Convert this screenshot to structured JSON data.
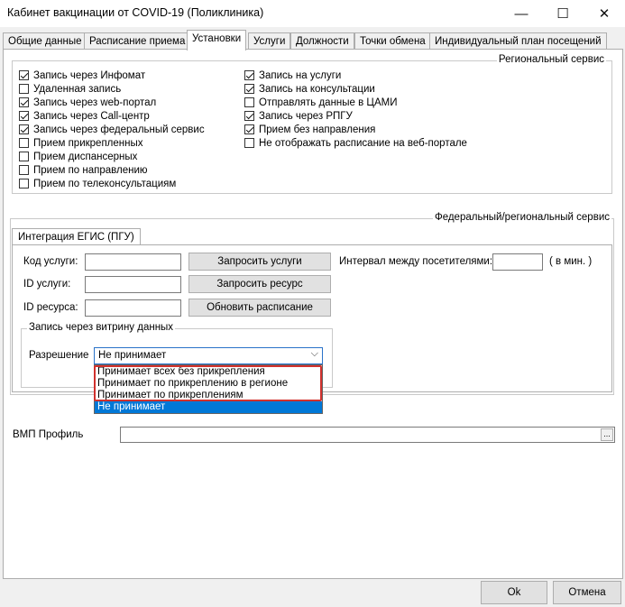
{
  "window": {
    "title": "Кабинет вакцинации от COVID-19 (Поликлиника)",
    "minimize_icon": "—",
    "maximize_icon": "☐",
    "close_icon": "✕"
  },
  "tabs": [
    {
      "label": "Общие данные"
    },
    {
      "label": "Расписание приема"
    },
    {
      "label": "Установки"
    },
    {
      "label": "Услуги"
    },
    {
      "label": "Должности"
    },
    {
      "label": "Точки обмена"
    },
    {
      "label": "Индивидуальный план посещений"
    }
  ],
  "regional": {
    "title": "Региональный сервис",
    "left": [
      {
        "label": "Запись через Инфомат",
        "checked": true
      },
      {
        "label": "Удаленная запись",
        "checked": false
      },
      {
        "label": "Запись через web-портал",
        "checked": true
      },
      {
        "label": "Запись через Call-центр",
        "checked": true
      },
      {
        "label": "Запись через федеральный сервис",
        "checked": true
      },
      {
        "label": "Прием прикрепленных",
        "checked": false
      },
      {
        "label": "Прием диспансерных",
        "checked": false
      },
      {
        "label": "Прием по направлению",
        "checked": false
      },
      {
        "label": "Прием по телеконсультациям",
        "checked": false
      }
    ],
    "right": [
      {
        "label": "Запись на услуги",
        "checked": true
      },
      {
        "label": "Запись на консультации",
        "checked": true
      },
      {
        "label": "Отправлять данные в ЦАМИ",
        "checked": false
      },
      {
        "label": "Запись через РПГУ",
        "checked": true
      },
      {
        "label": "Прием без направления",
        "checked": true
      },
      {
        "label": "Не отображать расписание на веб-портале",
        "checked": false
      }
    ]
  },
  "federal": {
    "title": "Федеральный/региональный сервис",
    "inner_tab": "Интеграция ЕГИС (ПГУ)",
    "service_code_label": "Код услуги:",
    "service_id_label": "ID услуги:",
    "resource_id_label": "ID ресурса:",
    "request_services_btn": "Запросить услуги",
    "request_resource_btn": "Запросить ресурс",
    "update_schedule_btn": "Обновить расписание",
    "interval_label": "Интервал между посетителями:",
    "interval_unit": "( в мин. )",
    "showcase_title": "Запись через витрину данных",
    "permission_label": "Разрешение",
    "permission_value": "Не принимает",
    "dropdown_icon": "⌵",
    "options": [
      {
        "label": "Принимает всех без прикрепления",
        "selected": false
      },
      {
        "label": "Принимает по прикреплению в регионе",
        "selected": false
      },
      {
        "label": "Принимает по прикреплениям",
        "selected": false
      },
      {
        "label": "Не принимает",
        "selected": true
      }
    ]
  },
  "vmp": {
    "label": "ВМП Профиль",
    "browse_icon": "..."
  },
  "footer": {
    "ok": "Ok",
    "cancel": "Отмена"
  },
  "colors": {
    "selection": "#0078d7",
    "highlight": "#d0312d"
  }
}
